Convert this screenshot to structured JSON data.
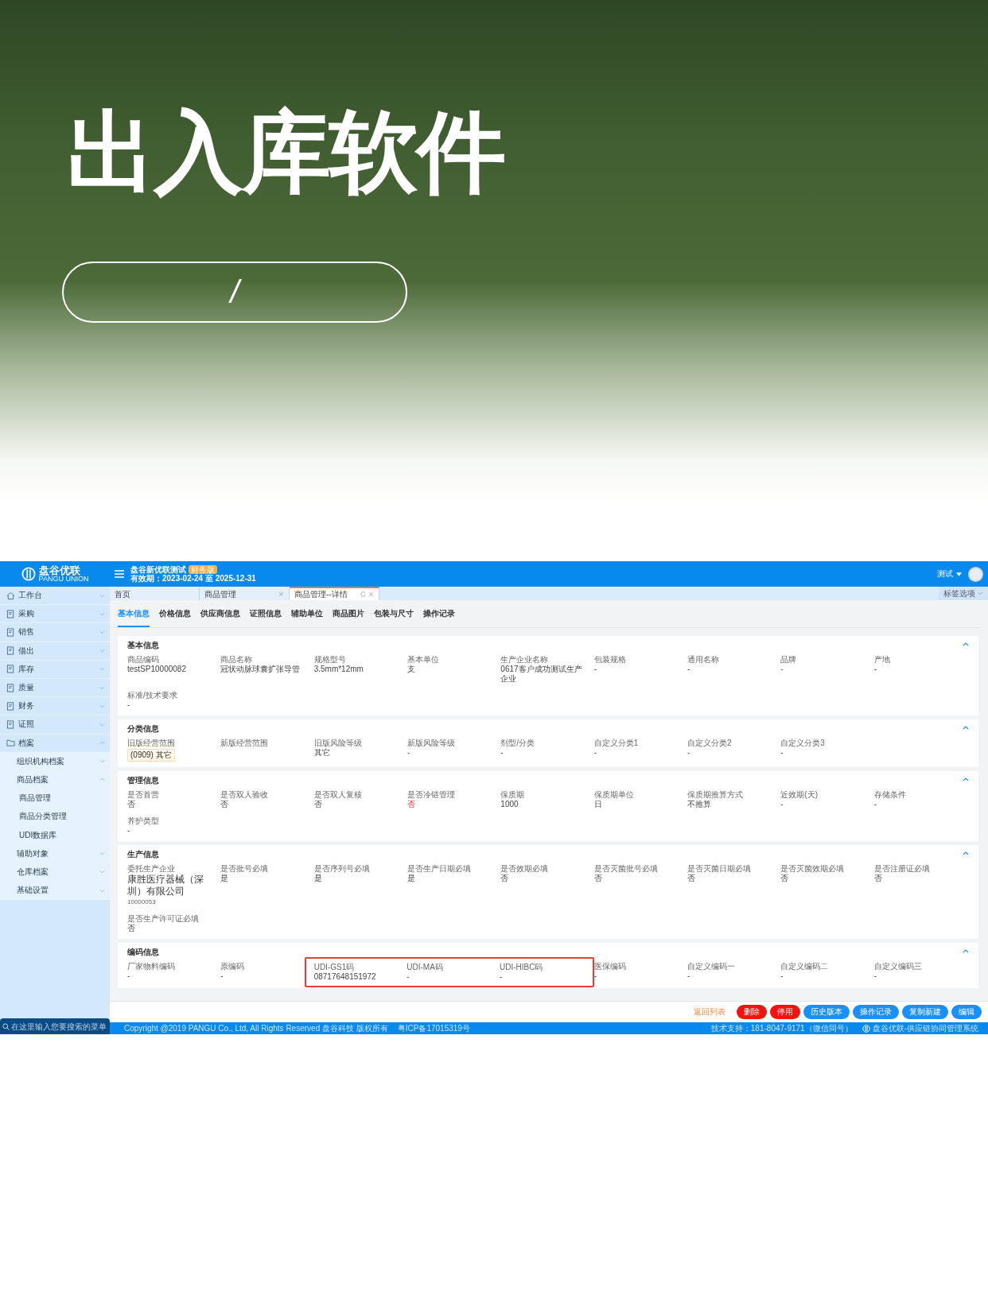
{
  "banner": {
    "title": "出入库软件",
    "pill_text": "/"
  },
  "header": {
    "logo_text": "盘谷优联",
    "logo_subtext": "PANGU UNION",
    "company": "盘谷新优联测试",
    "edition_badge": "财务版",
    "validity": "有效期：2023-02-24 至 2025-12-31",
    "user": "测试"
  },
  "sidebar": {
    "items": [
      {
        "label": "工作台",
        "expanded": false
      },
      {
        "label": "采购",
        "expanded": false
      },
      {
        "label": "销售",
        "expanded": false
      },
      {
        "label": "借出",
        "expanded": false
      },
      {
        "label": "库存",
        "expanded": false
      },
      {
        "label": "质量",
        "expanded": false
      },
      {
        "label": "财务",
        "expanded": false
      },
      {
        "label": "证照",
        "expanded": false
      },
      {
        "label": "档案",
        "expanded": true,
        "children": [
          {
            "label": "组织机构档案",
            "expanded": false
          },
          {
            "label": "商品档案",
            "expanded": true,
            "children": [
              {
                "label": "商品管理"
              },
              {
                "label": "商品分类管理"
              },
              {
                "label": "UDI数据库"
              }
            ]
          },
          {
            "label": "辅助对象",
            "expanded": false
          },
          {
            "label": "仓库档案",
            "expanded": false
          },
          {
            "label": "基础设置",
            "expanded": false
          }
        ]
      }
    ],
    "search": {
      "placeholder": "在这里输入您要搜索的菜单"
    }
  },
  "tabs": [
    {
      "label": "首页",
      "selected": false,
      "closable": false,
      "refreshable": false
    },
    {
      "label": "商品管理",
      "selected": false,
      "closable": true,
      "refreshable": false
    },
    {
      "label": "商品管理--详情",
      "selected": true,
      "closable": true,
      "refreshable": true
    }
  ],
  "tab_options": "标签选项",
  "subtabs": [
    {
      "label": "基本信息",
      "selected": true
    },
    {
      "label": "价格信息",
      "selected": false
    },
    {
      "label": "供应商信息",
      "selected": false
    },
    {
      "label": "证照信息",
      "selected": false
    },
    {
      "label": "辅助单位",
      "selected": false
    },
    {
      "label": "商品图片",
      "selected": false
    },
    {
      "label": "包装与尺寸",
      "selected": false
    },
    {
      "label": "操作记录",
      "selected": false
    }
  ],
  "sections": [
    {
      "title": "基本信息",
      "fields": [
        {
          "label": "商品编码",
          "value": "testSP10000082",
          "kind": "text"
        },
        {
          "label": "商品名称",
          "value": "冠状动脉球囊扩张导管",
          "kind": "text"
        },
        {
          "label": "规格型号",
          "value": "3.5mm*12mm",
          "kind": "text"
        },
        {
          "label": "基本单位",
          "value": "支",
          "kind": "text"
        },
        {
          "label": "生产企业名称",
          "value": "0617客户成功测试生产企业",
          "kind": "text"
        },
        {
          "label": "包装规格",
          "value": "-",
          "kind": "text"
        },
        {
          "label": "通用名称",
          "value": "-",
          "kind": "text"
        },
        {
          "label": "品牌",
          "value": "-",
          "kind": "text"
        },
        {
          "label": "产地",
          "value": "-",
          "kind": "text"
        },
        {
          "label": "标准/技术要求",
          "value": "-",
          "kind": "text"
        }
      ]
    },
    {
      "title": "分类信息",
      "fields": [
        {
          "label": "旧版经营范围",
          "value": "(0909) 其它",
          "kind": "tag"
        },
        {
          "label": "新版经营范围",
          "kind": "text"
        },
        {
          "label": "旧版风险等级",
          "value": "其它",
          "kind": "text"
        },
        {
          "label": "新版风险等级",
          "value": "-",
          "kind": "text"
        },
        {
          "label": "剂型/分类",
          "value": "-",
          "kind": "text"
        },
        {
          "label": "自定义分类1",
          "value": "-",
          "kind": "text"
        },
        {
          "label": "自定义分类2",
          "value": "-",
          "kind": "text"
        },
        {
          "label": "自定义分类3",
          "value": "-",
          "kind": "text"
        }
      ]
    },
    {
      "title": "管理信息",
      "fields": [
        {
          "label": "是否首营",
          "value": "否",
          "kind": "text"
        },
        {
          "label": "是否双人验收",
          "value": "否",
          "kind": "text"
        },
        {
          "label": "是否双人复核",
          "value": "否",
          "kind": "text"
        },
        {
          "label": "是否冷链管理",
          "value": "否",
          "kind": "alert"
        },
        {
          "label": "保质期",
          "value": "1000",
          "kind": "text"
        },
        {
          "label": "保质期单位",
          "value": "日",
          "kind": "text"
        },
        {
          "label": "保质期推算方式",
          "value": "不推算",
          "kind": "text"
        },
        {
          "label": "近效期(天)",
          "value": "-",
          "kind": "text"
        },
        {
          "label": "存储条件",
          "value": "-",
          "kind": "text"
        },
        {
          "label": "养护类型",
          "value": "-",
          "kind": "text"
        }
      ]
    },
    {
      "title": "生产信息",
      "fields": [
        {
          "label": "委托生产企业",
          "value": "康胜医疗器械（深圳）有限公司",
          "note": "10000053",
          "kind": "large"
        },
        {
          "label": "是否批号必填",
          "value": "是",
          "kind": "text"
        },
        {
          "label": "是否序列号必填",
          "value": "是",
          "kind": "text"
        },
        {
          "label": "是否生产日期必填",
          "value": "是",
          "kind": "text"
        },
        {
          "label": "是否效期必填",
          "value": "否",
          "kind": "text"
        },
        {
          "label": "是否灭菌批号必填",
          "value": "否",
          "kind": "text"
        },
        {
          "label": "是否灭菌日期必填",
          "value": "否",
          "kind": "text"
        },
        {
          "label": "是否灭菌效期必填",
          "value": "否",
          "kind": "text"
        },
        {
          "label": "是否注册证必填",
          "value": "否",
          "kind": "text"
        },
        {
          "label": "是否生产许可证必填",
          "value": "否",
          "kind": "text"
        }
      ]
    },
    {
      "title": "编码信息",
      "fields": [
        {
          "label": "厂家物料编码",
          "value": "-",
          "kind": "text",
          "highlighted": false
        },
        {
          "label": "原编码",
          "value": "-",
          "kind": "text",
          "highlighted": false
        },
        {
          "label": "UDI-GS1码",
          "value": "08717648151972",
          "kind": "text",
          "highlighted": true
        },
        {
          "label": "UDI-MA码",
          "value": "-",
          "kind": "text",
          "highlighted": true
        },
        {
          "label": "UDI-HIBC码",
          "value": "-",
          "kind": "text",
          "highlighted": true
        },
        {
          "label": "医保编码",
          "value": "-",
          "kind": "text",
          "highlighted": false
        },
        {
          "label": "自定义编码一",
          "value": "-",
          "kind": "text",
          "highlighted": false
        },
        {
          "label": "自定义编码二",
          "value": "-",
          "kind": "text",
          "highlighted": false
        },
        {
          "label": "自定义编码三",
          "value": "-",
          "kind": "text",
          "highlighted": false
        }
      ]
    }
  ],
  "actions": [
    {
      "label": "返回列表",
      "kind": "link"
    },
    {
      "label": "删除",
      "kind": "danger"
    },
    {
      "label": "停用",
      "kind": "danger"
    },
    {
      "label": "历史版本",
      "kind": "primary"
    },
    {
      "label": "操作记录",
      "kind": "primary"
    },
    {
      "label": "复制新建",
      "kind": "primary"
    },
    {
      "label": "编辑",
      "kind": "primary"
    }
  ],
  "footer": {
    "copyright": "Copyright @2019 PANGU Co., Ltd, All Rights Reserved 盘谷科技 版权所有",
    "icp": "粤ICP备17015319号",
    "support": "技术支持：181-8047-9171（微信同号）",
    "system": "盘谷优联-供应链协同管理系统"
  }
}
